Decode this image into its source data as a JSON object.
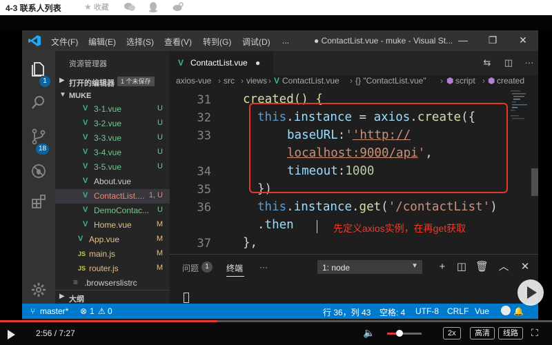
{
  "course": {
    "title": "4-3 联系人列表",
    "favorite_label": "收藏"
  },
  "vscode": {
    "menu": [
      "文件(F)",
      "编辑(E)",
      "选择(S)",
      "查看(V)",
      "转到(G)",
      "调试(D)",
      "..."
    ],
    "window_title": "● ContactList.vue - muke - Visual St...",
    "activity_badges": {
      "explorer": "1",
      "source_control": "18"
    },
    "sidebar": {
      "title": "资源管理器",
      "open_editors": {
        "label": "打开的编辑器",
        "badge": "1 个未保存"
      },
      "project": "MUKE",
      "files": [
        {
          "name": "3-1.vue",
          "status": "U"
        },
        {
          "name": "3-2.vue",
          "status": "U"
        },
        {
          "name": "3-3.vue",
          "status": "U"
        },
        {
          "name": "3-4.vue",
          "status": "U"
        },
        {
          "name": "3-5.vue",
          "status": "U"
        },
        {
          "name": "About.vue",
          "status": ""
        },
        {
          "name": "ContactList....",
          "status": "1, U"
        },
        {
          "name": "DemoContac...",
          "status": "U"
        },
        {
          "name": "Home.vue",
          "status": "M"
        },
        {
          "name": "App.vue",
          "status": "M"
        },
        {
          "name": "main.js",
          "status": "M"
        },
        {
          "name": "router.js",
          "status": "M"
        },
        {
          "name": ".browserslistrc",
          "status": ""
        }
      ],
      "js_icon_text": "JS",
      "outline_label": "大纲"
    },
    "tab": {
      "label": "ContactList.vue",
      "dirty": "●"
    },
    "breadcrumb": [
      "axios-vue",
      "src",
      "views",
      "ContactList.vue",
      "{} \"ContactList.vue\"",
      "script",
      "created"
    ],
    "editor": {
      "line_numbers": [
        "31",
        "32",
        "33",
        "34",
        "35",
        "36",
        "37"
      ],
      "code": {
        "l31": "created() {",
        "l32_this": "this",
        "l32_rest1": ".",
        "l32_instance": "instance",
        "l32_eq": " = ",
        "l32_axios": "axios",
        "l32_dot": ".",
        "l32_create": "create",
        "l32_end": "({",
        "l33_key": "baseURL",
        "l33_colon": ":",
        "l33_str1": "'http://",
        "l33b_str2": "localhost:9000/api",
        "l33b_str3": "'",
        "l33b_comma": ",",
        "l34_key": "timeout",
        "l34_colon": ":",
        "l34_num": "1000",
        "l35": "})",
        "l36_this": "this",
        "l36_dot1": ".",
        "l36_instance": "instance",
        "l36_dot2": ".",
        "l36_get": "get",
        "l36_open": "(",
        "l36_str": "'/contactList'",
        "l36_close": ")",
        "l36b_dot": ".",
        "l36b_then": "then",
        "l37": "},"
      },
      "annotation": "先定义axios实例，在再get获取"
    },
    "panel": {
      "problems_label": "问题",
      "problems_count": "1",
      "terminal_label": "终端",
      "more": "···",
      "terminal_select": "1: node"
    },
    "statusbar": {
      "branch": "master*",
      "errors": "1",
      "warnings": "0",
      "position": "行 36，列 43",
      "spaces": "空格: 4",
      "encoding": "UTF-8",
      "eol": "CRLF",
      "language": "Vue"
    }
  },
  "video": {
    "time": "2:56 / 7:27",
    "progress": 0.394,
    "volume": 0.35,
    "speed": "2x",
    "quality": "高清",
    "route": "线路"
  }
}
